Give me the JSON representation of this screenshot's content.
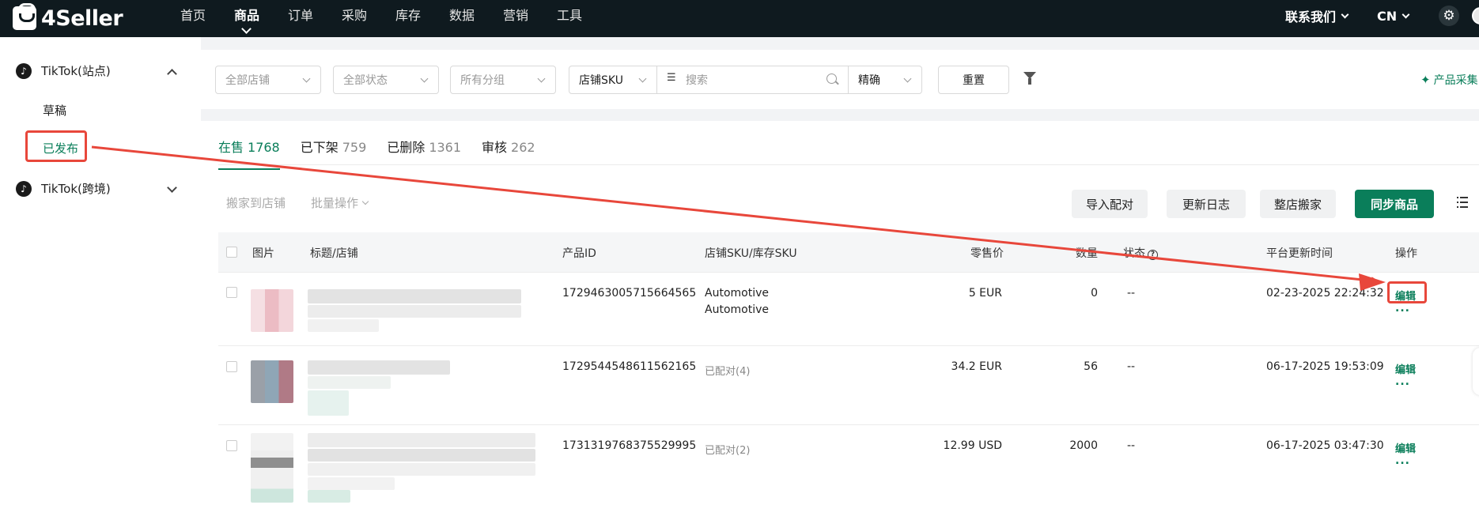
{
  "brand": {
    "name": "4Seller"
  },
  "topnav": {
    "items": [
      {
        "label": "首页",
        "active": false
      },
      {
        "label": "商品",
        "active": true
      },
      {
        "label": "订单",
        "active": false
      },
      {
        "label": "采购",
        "active": false
      },
      {
        "label": "库存",
        "active": false
      },
      {
        "label": "数据",
        "active": false
      },
      {
        "label": "营销",
        "active": false
      },
      {
        "label": "工具",
        "active": false
      }
    ],
    "contact": "联系我们",
    "lang": "CN",
    "settings_icon": "gear-icon"
  },
  "sidebar": {
    "group1": {
      "label": "TikTok(站点)",
      "expanded": true
    },
    "sub": [
      {
        "label": "草稿",
        "active": false
      },
      {
        "label": "已发布",
        "active": true
      }
    ],
    "group2": {
      "label": "TikTok(跨境)",
      "expanded": false
    }
  },
  "filters": {
    "store": "全部店铺",
    "status": "全部状态",
    "group": "所有分组",
    "search_field": "店铺SKU",
    "search_placeholder": "搜索",
    "match": "精确",
    "reset": "重置",
    "collect": "产品采集"
  },
  "tabs": [
    {
      "label": "在售",
      "count": "1768",
      "active": true
    },
    {
      "label": "已下架",
      "count": "759",
      "active": false
    },
    {
      "label": "已删除",
      "count": "1361",
      "active": false
    },
    {
      "label": "审核",
      "count": "262",
      "active": false
    }
  ],
  "toolbar": {
    "move_to_store": "搬家到店铺",
    "batch": "批量操作",
    "import_match": "导入配对",
    "update_log": "更新日志",
    "store_move": "整店搬家",
    "sync": "同步商品"
  },
  "table": {
    "headers": {
      "image": "图片",
      "title_store": "标题/店铺",
      "product_id": "产品ID",
      "sku": "店铺SKU/库存SKU",
      "price": "零售价",
      "qty": "数量",
      "status": "状态",
      "updated": "平台更新时间",
      "action": "操作"
    },
    "rows": [
      {
        "product_id": "1729463005715664565",
        "sku_line1": "Automotive",
        "sku_line2": "Automotive",
        "price": "5 EUR",
        "qty": "0",
        "status": "--",
        "updated": "02-23-2025 22:24:32",
        "edit": "编辑",
        "more": "..."
      },
      {
        "product_id": "1729544548611562165",
        "sku_line1": "已配对(4)",
        "sku_line2": "",
        "price": "34.2 EUR",
        "qty": "56",
        "status": "--",
        "updated": "06-17-2025 19:53:09",
        "edit": "编辑",
        "more": "..."
      },
      {
        "product_id": "1731319768375529995",
        "sku_line1": "已配对(2)",
        "sku_line2": "",
        "price": "12.99 USD",
        "qty": "2000",
        "status": "--",
        "updated": "06-17-2025 03:47:30",
        "edit": "编辑",
        "more": "..."
      }
    ]
  },
  "colors": {
    "accent": "#0a7e5a",
    "annotation": "#e8473b",
    "topbar": "#0f1a1f"
  }
}
